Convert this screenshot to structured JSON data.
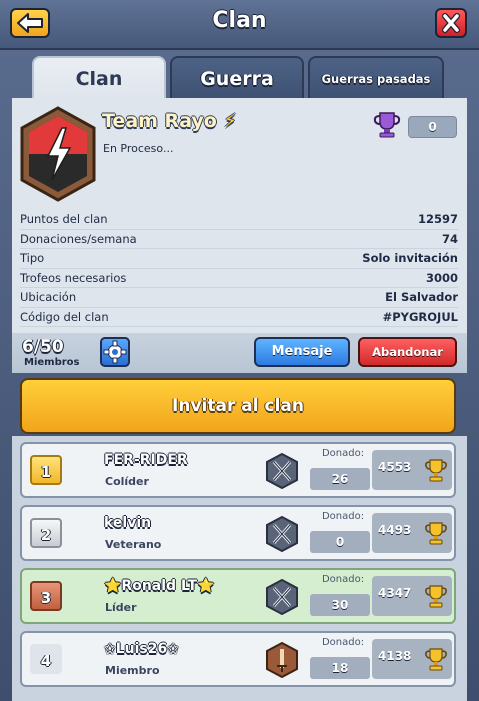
{
  "header": {
    "title": "Clan"
  },
  "tabs": [
    {
      "label": "Clan",
      "active": true
    },
    {
      "label": "Guerra",
      "active": false
    },
    {
      "label": "Guerras pasadas",
      "active": false
    }
  ],
  "clan": {
    "name": "Team Rayo",
    "bolt": "⚡",
    "description": "En Proceso...",
    "trophies": "0"
  },
  "stats": [
    {
      "label": "Puntos del clan",
      "value": "12597"
    },
    {
      "label": "Donaciones/semana",
      "value": "74"
    },
    {
      "label": "Tipo",
      "value": "Solo invitación"
    },
    {
      "label": "Trofeos necesarios",
      "value": "3000"
    },
    {
      "label": "Ubicación",
      "value": "El Salvador"
    },
    {
      "label": "Código del clan",
      "value": "#PYGROJUL"
    }
  ],
  "members_bar": {
    "count": "6/50",
    "label": "Miembros",
    "message_button": "Mensaje",
    "leave_button": "Abandonar"
  },
  "invite_button": "Invitar al clan",
  "members": [
    {
      "rank": "1",
      "name": "FER-RIDER",
      "role": "Colíder",
      "donated_label": "Donado:",
      "donated": "26",
      "trophies": "4553",
      "icon": "crossed-swords-icon",
      "rank_style": "gold"
    },
    {
      "rank": "2",
      "name": "kelvin",
      "role": "Veterano",
      "donated_label": "Donado:",
      "donated": "0",
      "trophies": "4493",
      "icon": "crossed-swords-icon",
      "rank_style": "silver"
    },
    {
      "rank": "3",
      "name": "⭐Ronald LT⭐",
      "role": "Líder",
      "donated_label": "Donado:",
      "donated": "30",
      "trophies": "4347",
      "icon": "crossed-swords-icon",
      "rank_style": "bronze"
    },
    {
      "rank": "4",
      "name": "✩Luis26✩",
      "role": "Miembro",
      "donated_label": "Donado:",
      "donated": "18",
      "trophies": "4138",
      "icon": "sword-icon",
      "rank_style": "plain"
    }
  ],
  "colors": {
    "accent": "#f2a41a",
    "panel": "#dfe5ec",
    "header": "#4d6285"
  }
}
